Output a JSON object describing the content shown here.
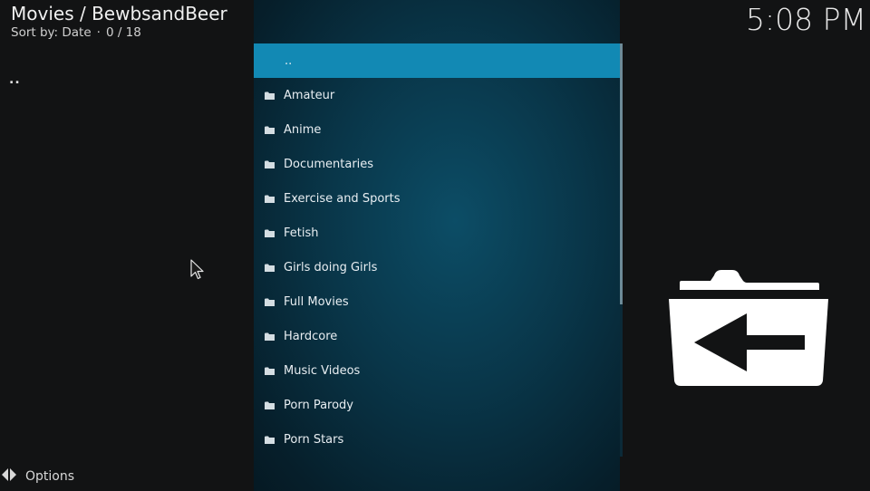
{
  "header": {
    "title": "Movies / BewbsandBeer",
    "sort_label": "Sort by: Date",
    "separator": "·",
    "position": "0 / 18"
  },
  "clock": "5:08 PM",
  "left_parent": "..",
  "list": {
    "items": [
      {
        "label": "..",
        "icon": "none",
        "focused": true
      },
      {
        "label": "Amateur",
        "icon": "folder-icon"
      },
      {
        "label": "Anime",
        "icon": "folder-icon"
      },
      {
        "label": "Documentaries",
        "icon": "folder-icon"
      },
      {
        "label": "Exercise and Sports",
        "icon": "folder-icon"
      },
      {
        "label": "Fetish",
        "icon": "folder-icon"
      },
      {
        "label": "Girls doing Girls",
        "icon": "folder-icon"
      },
      {
        "label": "Full Movies",
        "icon": "folder-icon"
      },
      {
        "label": "Hardcore",
        "icon": "folder-icon"
      },
      {
        "label": "Music Videos",
        "icon": "folder-icon"
      },
      {
        "label": "Porn Parody",
        "icon": "folder-icon"
      },
      {
        "label": "Porn Stars",
        "icon": "folder-icon"
      }
    ]
  },
  "options": {
    "label": "Options",
    "icon": "options-arrows-icon"
  },
  "preview_icon": "folder-back-icon",
  "colors": {
    "focus": "#1289b4",
    "panel": "#093649",
    "background": "#121314"
  }
}
